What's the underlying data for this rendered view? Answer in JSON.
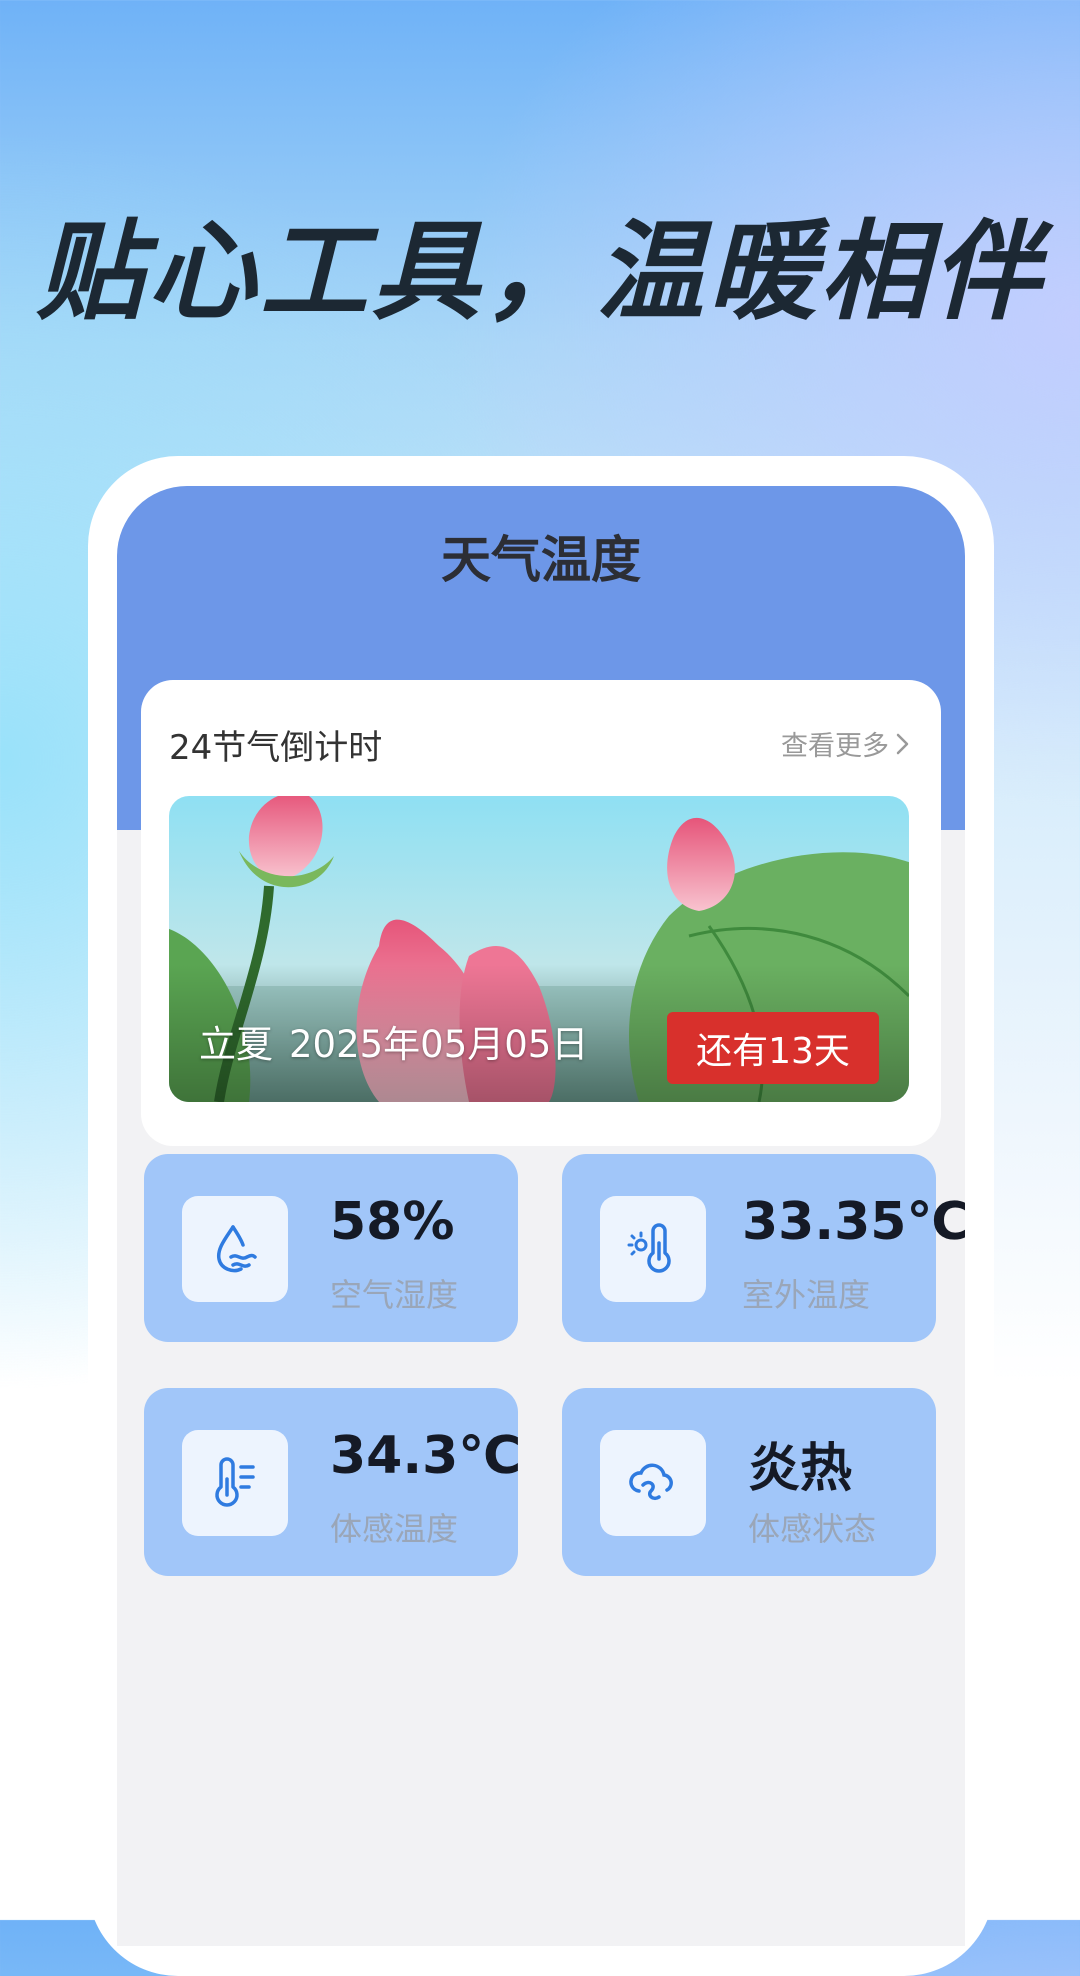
{
  "slogan": "贴心工具，温暖相伴",
  "screen": {
    "title": "天气温度",
    "solar_term_card": {
      "title": "24节气倒计时",
      "more_label": "查看更多",
      "term_name": "立夏",
      "term_date": "2025年05月05日",
      "countdown": "还有13天"
    },
    "stats": [
      {
        "icon": "humidity-icon",
        "value": "58%",
        "label": "空气湿度"
      },
      {
        "icon": "outdoor-temperature-icon",
        "value": "33.35℃",
        "label": "室外温度"
      },
      {
        "icon": "feels-like-temperature-icon",
        "value": "34.3℃",
        "label": "体感温度"
      },
      {
        "icon": "weather-condition-icon",
        "value": "炎热",
        "label": "体感状态"
      }
    ]
  },
  "colors": {
    "header_blue": "#6d97e8",
    "stat_card_blue": "#a1c6f9",
    "icon_blue": "#2f7be0",
    "countdown_red": "#d8302c"
  }
}
